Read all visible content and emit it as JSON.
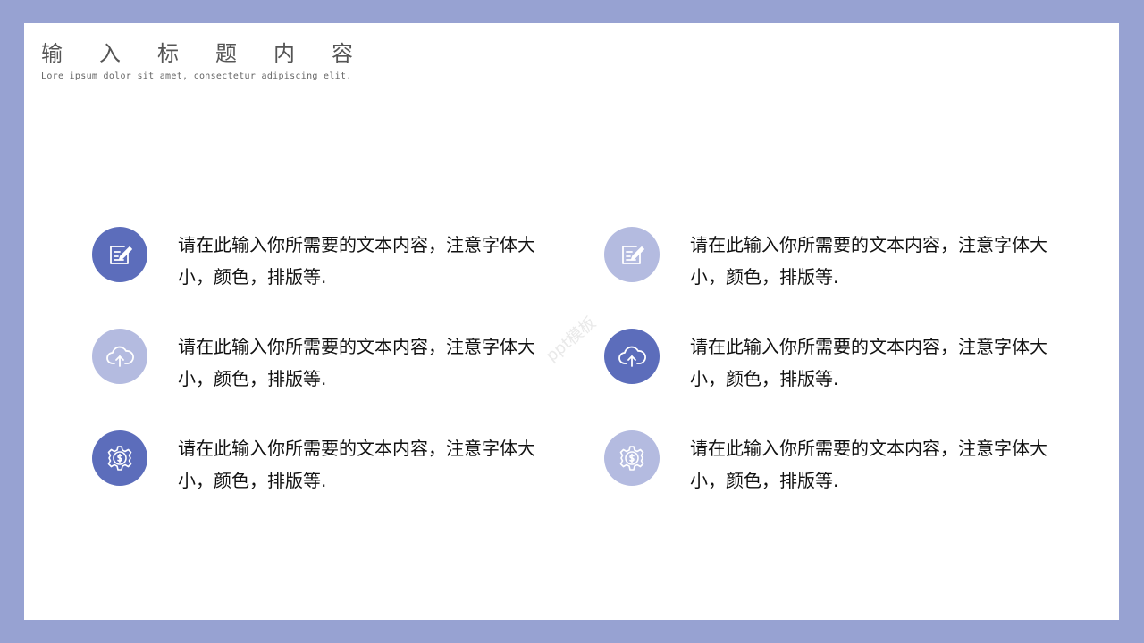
{
  "header": {
    "title": "输入标题内容",
    "subtitle": "Lore ipsum dolor sit amet, consectetur adipiscing elit."
  },
  "watermark": "ppt模板",
  "colors": {
    "frame": "#97a2d2",
    "dark_circle": "#5c6dbb",
    "light_circle": "#b4bbe0"
  },
  "items": [
    {
      "icon": "note-edit-icon",
      "tone": "dark",
      "text": "请在此输入你所需要的文本内容，注意字体大小，颜色，排版等."
    },
    {
      "icon": "cloud-upload-icon",
      "tone": "light",
      "text": "请在此输入你所需要的文本内容，注意字体大小，颜色，排版等."
    },
    {
      "icon": "gear-dollar-icon",
      "tone": "dark",
      "text": "请在此输入你所需要的文本内容，注意字体大小，颜色，排版等."
    },
    {
      "icon": "note-edit-icon",
      "tone": "light",
      "text": "请在此输入你所需要的文本内容，注意字体大小，颜色，排版等."
    },
    {
      "icon": "cloud-upload-icon",
      "tone": "dark",
      "text": "请在此输入你所需要的文本内容，注意字体大小，颜色，排版等."
    },
    {
      "icon": "gear-dollar-icon",
      "tone": "light",
      "text": "请在此输入你所需要的文本内容，注意字体大小，颜色，排版等."
    }
  ]
}
